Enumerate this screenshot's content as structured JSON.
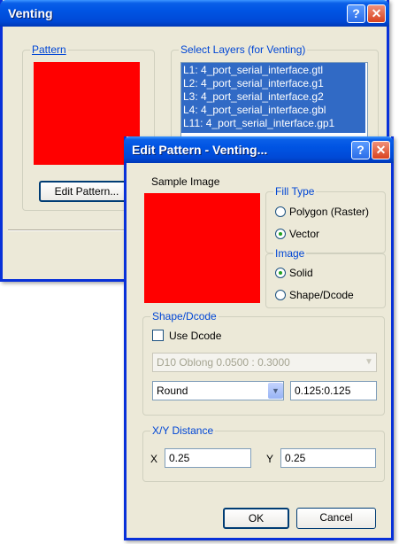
{
  "venting": {
    "title": "Venting",
    "pattern_group_label": "Pattern",
    "edit_pattern_button": "Edit Pattern...",
    "layers_group_label": "Select Layers (for Venting)",
    "layers": [
      "L1: 4_port_serial_interface.gtl",
      "L2: 4_port_serial_interface.g1",
      "L3: 4_port_serial_interface.g2",
      "L4: 4_port_serial_interface.gbl",
      "L11: 4_port_serial_interface.gp1"
    ]
  },
  "edit_pattern": {
    "title": "Edit Pattern - Venting...",
    "sample_image_label": "Sample Image",
    "fill_type_label": "Fill Type",
    "fill_polygon_label": "Polygon (Raster)",
    "fill_vector_label": "Vector",
    "image_label": "Image",
    "image_solid_label": "Solid",
    "image_shape_label": "Shape/Dcode",
    "shape_group_label": "Shape/Dcode",
    "use_dcode_label": "Use Dcode",
    "dcode_select_value": "D10    Oblong   0.0500 : 0.3000",
    "shape_select_value": "Round",
    "shape_size_value": "0.125:0.125",
    "xy_group_label": "X/Y Distance",
    "x_label": "X",
    "x_value": "0.25",
    "y_label": "Y",
    "y_value": "0.25",
    "ok_button": "OK",
    "cancel_button": "Cancel"
  },
  "colors": {
    "pattern_fill": "#ff0000",
    "selection": "#316ac5",
    "title_blue": "#0054e3"
  }
}
